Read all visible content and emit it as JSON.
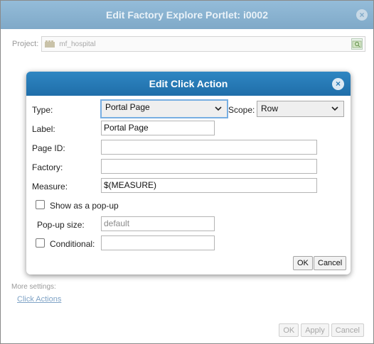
{
  "outer_dialog": {
    "title": "Edit Factory Explore Portlet: i0002",
    "close_glyph": "×",
    "project_label": "Project:",
    "project_value": "mf_hospital",
    "more_settings_label": "More settings:",
    "click_actions_link": "Click Actions",
    "buttons": {
      "ok": "OK",
      "apply": "Apply",
      "cancel": "Cancel"
    }
  },
  "inner_dialog": {
    "title": "Edit Click Action",
    "close_glyph": "×",
    "type_label": "Type:",
    "type_value": "Portal Page",
    "scope_label": "Scope:",
    "scope_value": "Row",
    "label_label": "Label:",
    "label_value": "Portal Page",
    "page_id_label": "Page ID:",
    "page_id_value": "",
    "factory_label": "Factory:",
    "factory_value": "",
    "measure_label": "Measure:",
    "measure_value": "$(MEASURE)",
    "popup_checkbox_label": "Show as a pop-up",
    "popup_checked": false,
    "popup_size_label": "Pop-up size:",
    "popup_size_placeholder": "default",
    "conditional_label": "Conditional:",
    "conditional_checked": false,
    "conditional_value": "",
    "buttons": {
      "ok": "OK",
      "cancel": "Cancel"
    }
  },
  "icons": {
    "project_folder": "folder-icon",
    "project_browse": "browse-icon",
    "dropdown": "chevron-down-icon",
    "close": "close-icon"
  },
  "colors": {
    "inner_titlebar": "#1f6ea9",
    "outer_titlebar": "#7fa9c8",
    "focus_ring": "#77aee2",
    "link": "#7fa3c6"
  }
}
